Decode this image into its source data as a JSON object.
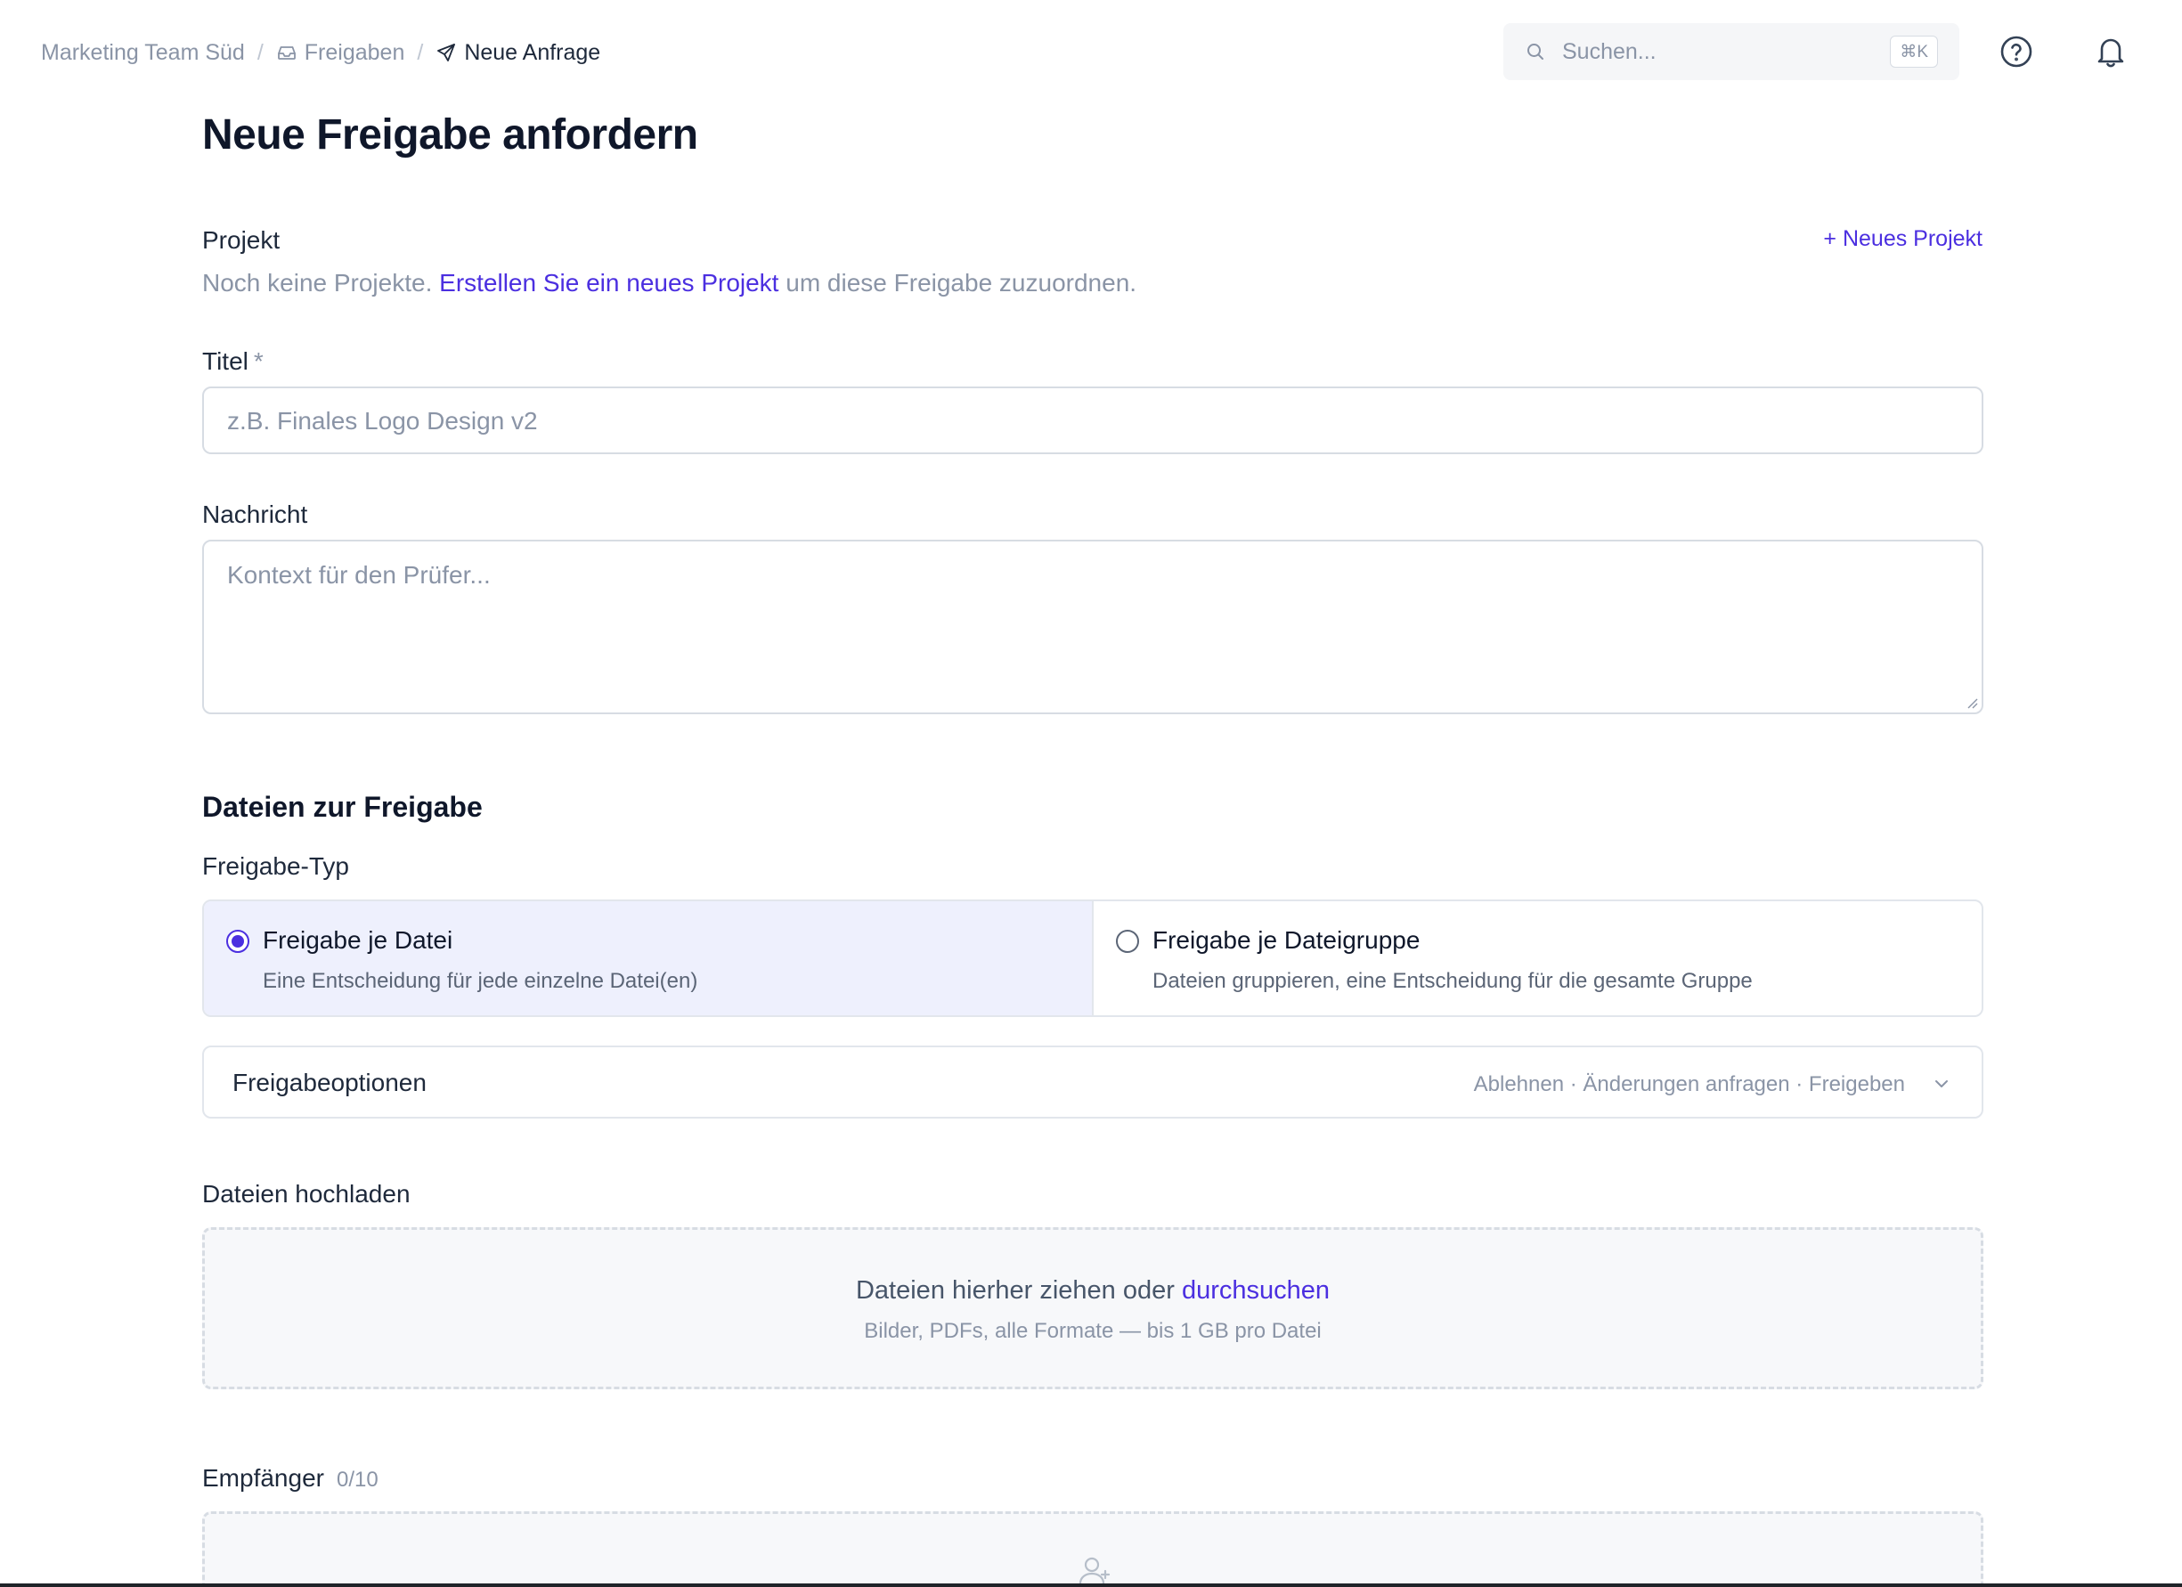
{
  "breadcrumb": {
    "workspace": "Marketing Team Süd",
    "section": "Freigaben",
    "current": "Neue Anfrage",
    "separator": "/"
  },
  "search": {
    "placeholder": "Suchen...",
    "shortcut": "⌘K"
  },
  "page": {
    "title": "Neue Freigabe anfordern"
  },
  "project": {
    "label": "Projekt",
    "new_button": "+ Neues Projekt",
    "help_prefix": "Noch keine Projekte.",
    "help_link": "Erstellen Sie ein neues Projekt",
    "help_suffix": "um diese Freigabe zuzuordnen."
  },
  "title_field": {
    "label": "Titel",
    "required_mark": "*",
    "placeholder": "z.B. Finales Logo Design v2"
  },
  "message_field": {
    "label": "Nachricht",
    "placeholder": "Kontext für den Prüfer..."
  },
  "files_section": {
    "heading": "Dateien zur Freigabe",
    "type_label": "Freigabe-Typ",
    "options": [
      {
        "title": "Freigabe je Datei",
        "description": "Eine Entscheidung für jede einzelne Datei(en)",
        "selected": true
      },
      {
        "title": "Freigabe je Dateigruppe",
        "description": "Dateien gruppieren, eine Entscheidung für die gesamte Gruppe",
        "selected": false
      }
    ],
    "approval_options": {
      "title": "Freigabeoptionen",
      "summary": "Ablehnen · Änderungen anfragen · Freigeben"
    },
    "upload": {
      "label": "Dateien hochladen",
      "text": "Dateien hierher ziehen oder",
      "link": "durchsuchen",
      "hint": "Bilder, PDFs, alle Formate — bis 1 GB pro Datei"
    }
  },
  "recipients": {
    "label": "Empfänger",
    "count": "0/10"
  },
  "colors": {
    "accent": "#4b2fe0",
    "selected_bg": "#eef0fd",
    "muted": "#8a94a6",
    "border": "#d7dce3"
  },
  "icons": [
    "inbox-icon",
    "send-icon",
    "search-icon",
    "help-circle-icon",
    "bell-icon",
    "chevron-down-icon",
    "user-plus-icon"
  ]
}
